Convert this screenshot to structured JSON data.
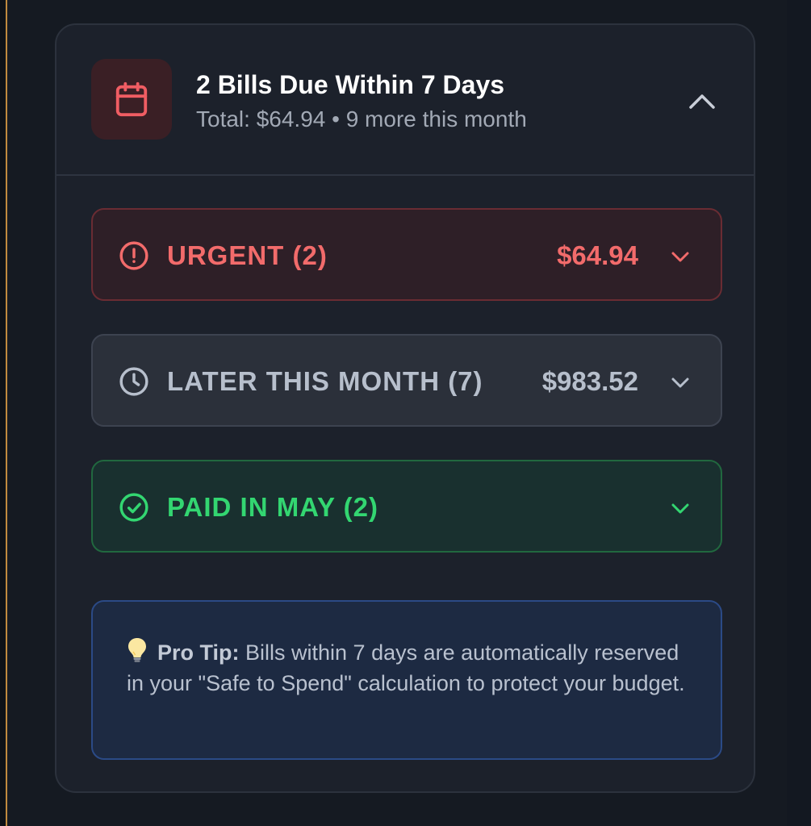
{
  "header": {
    "icon": "calendar-icon",
    "title": "2 Bills Due Within 7 Days",
    "subtitle": "Total: $64.94 • 9 more this month",
    "collapse_icon": "chevron-up-icon"
  },
  "sections": {
    "urgent": {
      "label": "URGENT (2)",
      "amount": "$64.94",
      "icon": "alert-circle-icon",
      "color": "#f26b6b"
    },
    "later": {
      "label": "LATER THIS MONTH (7)",
      "amount": "$983.52",
      "icon": "clock-icon",
      "color": "#b7bfcc"
    },
    "paid": {
      "label": "PAID IN MAY (2)",
      "icon": "check-circle-icon",
      "color": "#33d671"
    }
  },
  "tip": {
    "icon": "lightbulb-icon",
    "label": "Pro Tip:",
    "text": " Bills within 7 days are automatically reserved in your \"Safe to Spend\" calculation to protect your budget."
  }
}
